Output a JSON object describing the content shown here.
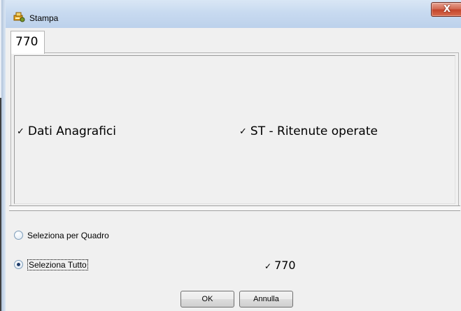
{
  "window": {
    "title": "Stampa",
    "close_glyph": "X",
    "title_icon": "printer-key-icon"
  },
  "tabs": [
    {
      "label": "770",
      "selected": true
    }
  ],
  "checkboxes": [
    {
      "label": "Dati Anagrafici",
      "checked": true
    },
    {
      "label": "ST - Ritenute operate",
      "checked": true
    }
  ],
  "selection": {
    "options": [
      {
        "label": "Seleziona per Quadro",
        "selected": false
      },
      {
        "label": "Seleziona Tutto",
        "selected": true
      }
    ],
    "all_check": {
      "label": "770",
      "checked": true
    }
  },
  "buttons": {
    "ok": "OK",
    "cancel": "Annulla"
  },
  "check_glyph": "✓",
  "colors": {
    "titlebar": "#c8daf0",
    "close_button": "#c2432a",
    "window_bg": "#f0f0f0"
  }
}
